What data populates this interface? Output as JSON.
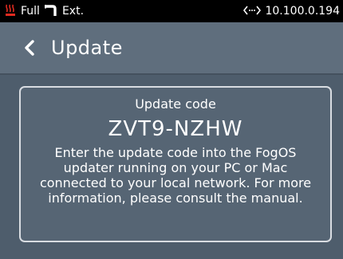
{
  "status_bar": {
    "power_label": "Full",
    "source_label": "Ext.",
    "ip_address": "10.100.0.194",
    "icons": {
      "power": "heater-icon",
      "source": "pipe-icon",
      "network": "network-arrows-icon"
    }
  },
  "header": {
    "title": "Update",
    "back_icon": "chevron-left-icon"
  },
  "card": {
    "label": "Update code",
    "code": "ZVT9-NZHW",
    "instructions": "Enter the update code into the FogOS updater running on your PC or Mac connected to your local network. For more information, please consult the manual."
  },
  "colors": {
    "status_bar_bg": "#000000",
    "header_bg": "#5f6e7d",
    "body_bg": "#4e5d6c",
    "card_bg": "#566574",
    "card_border": "#d9dde2",
    "heater_icon": "#e02b20"
  }
}
